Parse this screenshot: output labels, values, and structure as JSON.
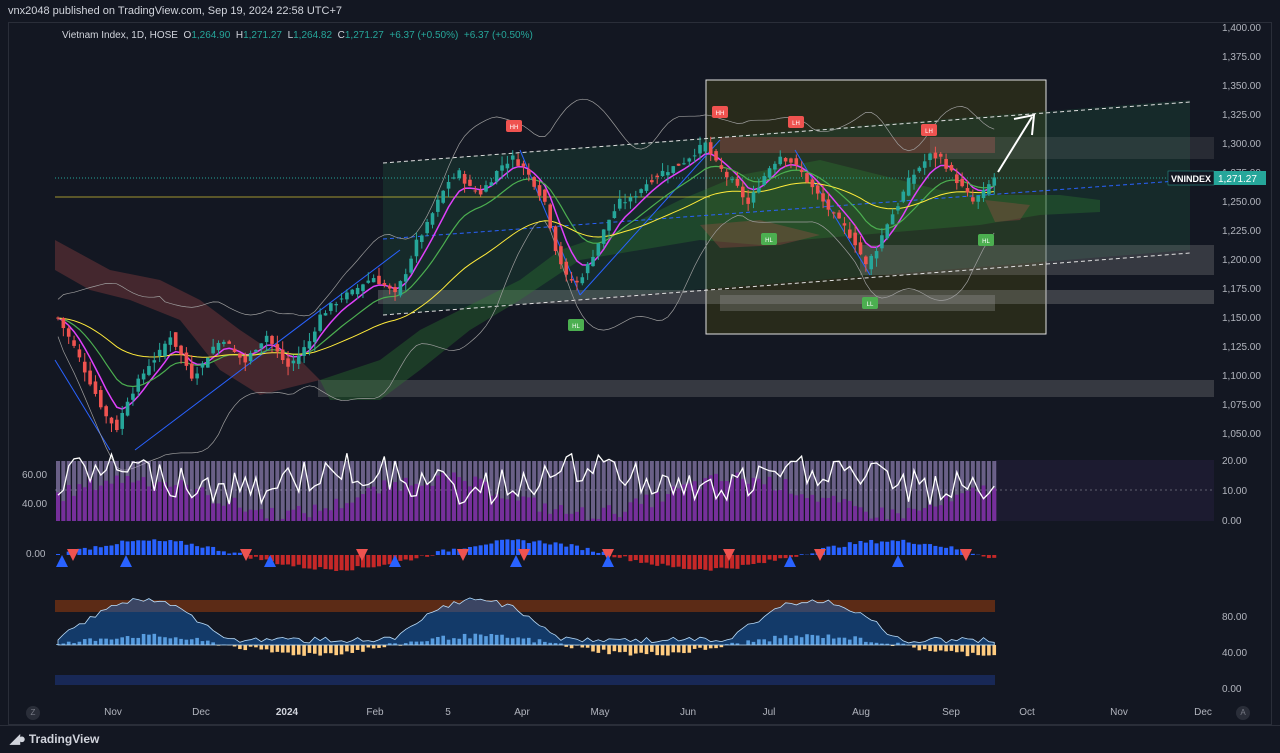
{
  "header": {
    "published": "vnx2048 published on TradingView.com, Sep 19, 2024 22:58 UTC+7"
  },
  "symbol": {
    "name": "Vietnam Index, 1D, HOSE",
    "open_label": "O",
    "open": "1,264.90",
    "high_label": "H",
    "high": "1,271.27",
    "low_label": "L",
    "low": "1,264.82",
    "close_label": "C",
    "close": "1,271.27",
    "change": "+6.37 (+0.50%)",
    "change2": "+6.37 (+0.50%)"
  },
  "price_tag": {
    "ticker": "VNINDEX",
    "value": "1,271.27"
  },
  "footer": {
    "brand": "TradingView"
  },
  "colors": {
    "background": "#131722",
    "up": "#26a69a",
    "down": "#ef5350",
    "ema_fast": "#e040fb",
    "ema_mid": "#4caf50",
    "ema_slow": "#ffeb3b"
  },
  "chart_data": {
    "type": "candlestick",
    "price_axis": [
      "1,400.00",
      "1,375.00",
      "1,350.00",
      "1,325.00",
      "1,300.00",
      "1,275.00",
      "1,250.00",
      "1,225.00",
      "1,200.00",
      "1,175.00",
      "1,150.00",
      "1,125.00",
      "1,100.00",
      "1,075.00",
      "1,050.00"
    ],
    "price_values": [
      1400,
      1375,
      1350,
      1325,
      1300,
      1275,
      1250,
      1225,
      1200,
      1175,
      1150,
      1125,
      1100,
      1075,
      1050
    ],
    "ylim": [
      1040,
      1405
    ],
    "time_axis": [
      "Nov",
      "Dec",
      "2024",
      "Feb",
      "5",
      "Apr",
      "May",
      "Jun",
      "Jul",
      "Aug",
      "Sep",
      "Oct",
      "Nov",
      "Dec"
    ],
    "rsi_axis": [
      "60.00",
      "40.00"
    ],
    "vol_axis": [
      "20.00",
      "10.00",
      "0.00"
    ],
    "macd_axis": [
      "0.00"
    ],
    "osc_axis": [
      "80.00",
      "40.00",
      "0.00"
    ],
    "last_close": 1271.27,
    "close_path": [
      [
        0,
        1150
      ],
      [
        3,
        1125
      ],
      [
        6,
        1095
      ],
      [
        9,
        1065
      ],
      [
        11,
        1055
      ],
      [
        13,
        1080
      ],
      [
        15,
        1095
      ],
      [
        17,
        1110
      ],
      [
        19,
        1120
      ],
      [
        21,
        1135
      ],
      [
        23,
        1118
      ],
      [
        25,
        1100
      ],
      [
        27,
        1110
      ],
      [
        29,
        1125
      ],
      [
        31,
        1132
      ],
      [
        33,
        1120
      ],
      [
        35,
        1112
      ],
      [
        37,
        1125
      ],
      [
        39,
        1135
      ],
      [
        41,
        1120
      ],
      [
        43,
        1108
      ],
      [
        45,
        1118
      ],
      [
        47,
        1130
      ],
      [
        49,
        1152
      ],
      [
        51,
        1160
      ],
      [
        53,
        1168
      ],
      [
        55,
        1172
      ],
      [
        57,
        1180
      ],
      [
        59,
        1185
      ],
      [
        61,
        1178
      ],
      [
        63,
        1170
      ],
      [
        65,
        1190
      ],
      [
        67,
        1215
      ],
      [
        69,
        1230
      ],
      [
        71,
        1250
      ],
      [
        73,
        1268
      ],
      [
        75,
        1275
      ],
      [
        77,
        1262
      ],
      [
        79,
        1258
      ],
      [
        81,
        1270
      ],
      [
        83,
        1282
      ],
      [
        85,
        1288
      ],
      [
        87,
        1280
      ],
      [
        89,
        1266
      ],
      [
        91,
        1250
      ],
      [
        93,
        1210
      ],
      [
        95,
        1185
      ],
      [
        97,
        1180
      ],
      [
        99,
        1195
      ],
      [
        101,
        1215
      ],
      [
        103,
        1235
      ],
      [
        105,
        1250
      ],
      [
        107,
        1252
      ],
      [
        109,
        1262
      ],
      [
        111,
        1270
      ],
      [
        113,
        1276
      ],
      [
        115,
        1280
      ],
      [
        117,
        1285
      ],
      [
        119,
        1293
      ],
      [
        121,
        1300
      ],
      [
        123,
        1283
      ],
      [
        125,
        1272
      ],
      [
        127,
        1262
      ],
      [
        129,
        1248
      ],
      [
        131,
        1265
      ],
      [
        133,
        1280
      ],
      [
        135,
        1290
      ],
      [
        137,
        1285
      ],
      [
        139,
        1275
      ],
      [
        141,
        1262
      ],
      [
        143,
        1250
      ],
      [
        145,
        1238
      ],
      [
        147,
        1228
      ],
      [
        149,
        1215
      ],
      [
        151,
        1195
      ],
      [
        153,
        1210
      ],
      [
        155,
        1232
      ],
      [
        157,
        1248
      ],
      [
        159,
        1268
      ],
      [
        161,
        1280
      ],
      [
        163,
        1290
      ],
      [
        165,
        1288
      ],
      [
        167,
        1275
      ],
      [
        169,
        1262
      ],
      [
        171,
        1250
      ],
      [
        173,
        1258
      ],
      [
        175,
        1271.27
      ]
    ],
    "labels": [
      {
        "text": "HH",
        "kind": "high"
      },
      {
        "text": "HH",
        "kind": "high"
      },
      {
        "text": "LH",
        "kind": "high"
      },
      {
        "text": "LH",
        "kind": "high"
      },
      {
        "text": "HL",
        "kind": "low"
      },
      {
        "text": "HL",
        "kind": "low"
      },
      {
        "text": "HL",
        "kind": "low"
      },
      {
        "text": "LL",
        "kind": "low"
      }
    ]
  }
}
